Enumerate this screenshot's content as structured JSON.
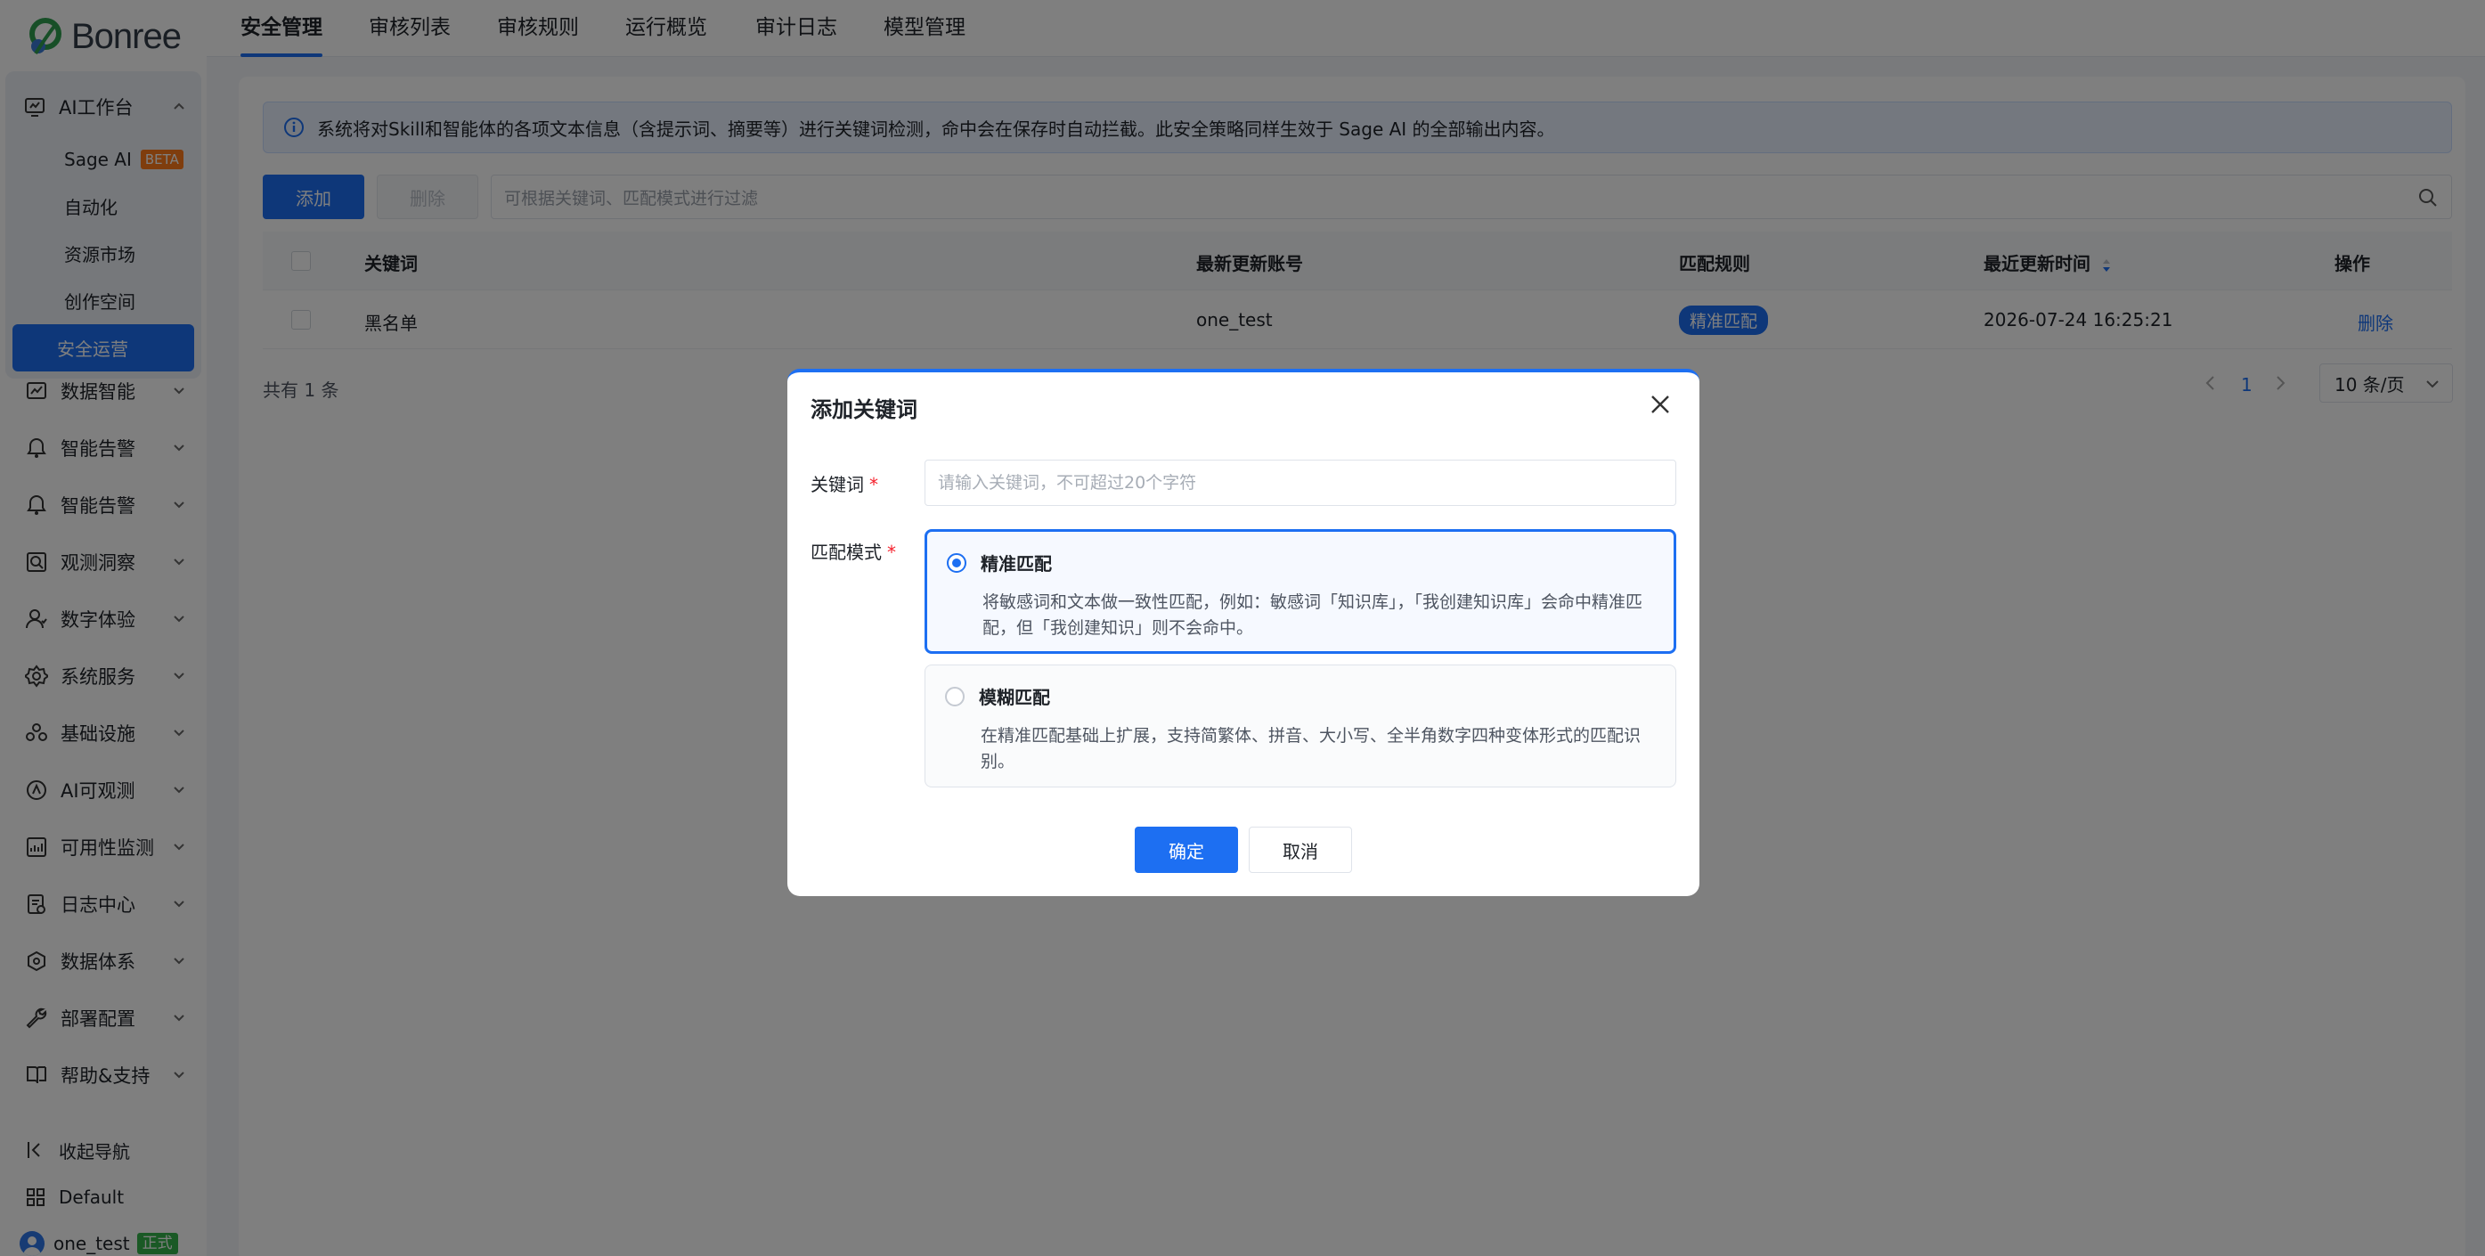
{
  "app": {
    "brand": "Bonree",
    "accent": "#1d6ff2"
  },
  "sidebar": {
    "group": {
      "label": "AI工作台",
      "icon": "ai-workbench-icon",
      "items": [
        {
          "label": "Sage AI",
          "badge": "BETA"
        },
        {
          "label": "自动化"
        },
        {
          "label": "资源市场"
        },
        {
          "label": "创作空间"
        },
        {
          "label": "安全运营",
          "active": true
        }
      ]
    },
    "items": [
      {
        "label": "数据智能",
        "icon": "chart-icon"
      },
      {
        "label": "智能告警",
        "icon": "alert-icon"
      },
      {
        "label": "智能告警",
        "icon": "alert-icon"
      },
      {
        "label": "观测洞察",
        "icon": "search-icon"
      },
      {
        "label": "数字体验",
        "icon": "user-icon"
      },
      {
        "label": "系统服务",
        "icon": "gear-icon"
      },
      {
        "label": "基础设施",
        "icon": "users-icon"
      },
      {
        "label": "AI可观测",
        "icon": "ai-icon"
      },
      {
        "label": "可用性监测",
        "icon": "monitor-icon"
      },
      {
        "label": "日志中心",
        "icon": "log-icon"
      },
      {
        "label": "数据体系",
        "icon": "data-icon"
      },
      {
        "label": "部署配置",
        "icon": "wrench-icon"
      },
      {
        "label": "帮助&支持",
        "icon": "book-icon"
      }
    ],
    "collapse": "收起导航",
    "workspace": "Default",
    "user": {
      "name": "one_test",
      "tag": "正式"
    }
  },
  "tabs": [
    "安全管理",
    "审核列表",
    "审核规则",
    "运行概览",
    "审计日志",
    "模型管理"
  ],
  "main": {
    "info": "系统将对Skill和智能体的各项文本信息（含提示词、摘要等）进行关键词检测，命中会在保存时自动拦截。此安全策略同样生效于 Sage AI 的全部输出内容。",
    "add_label": "添加",
    "delete_label": "删除",
    "filter_placeholder": "可根据关键词、匹配模式进行过滤",
    "columns": [
      "关键词",
      "最新更新账号",
      "匹配规则",
      "最近更新时间",
      "操作"
    ],
    "rows": [
      {
        "keyword": "黑名单",
        "account": "one_test",
        "rule": "精准匹配",
        "time": "2026-07-24 16:25:21",
        "action": "删除"
      }
    ],
    "total": "共有 1 条",
    "page": "1",
    "page_size": "10 条/页"
  },
  "modal": {
    "title": "添加关键词",
    "keyword_label": "关键词",
    "keyword_placeholder": "请输入关键词，不可超过20个字符",
    "mode_label": "匹配模式",
    "required": "*",
    "options": [
      {
        "title": "精准匹配",
        "desc": "将敏感词和文本做一致性匹配，例如：敏感词「知识库」，「我创建知识库」会命中精准匹配，但「我创建知识」则不会命中。",
        "selected": true
      },
      {
        "title": "模糊匹配",
        "desc": "在精准匹配基础上扩展，支持简繁体、拼音、大小写、全半角数字四种变体形式的匹配识别。",
        "selected": false
      }
    ],
    "ok": "确定",
    "cancel": "取消"
  }
}
